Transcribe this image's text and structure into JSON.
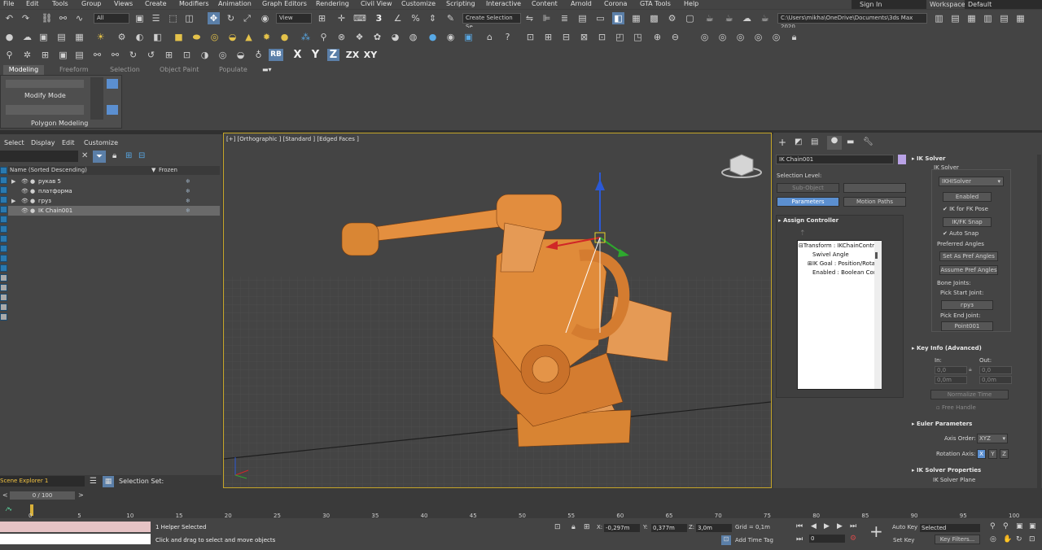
{
  "menubar": {
    "items": [
      "File",
      "Edit",
      "Tools",
      "Group",
      "Views",
      "Create",
      "Modifiers",
      "Animation",
      "Graph Editors",
      "Rendering",
      "Civil View",
      "Customize",
      "Scripting",
      "Interactive",
      "Content",
      "Arnold",
      "Corona",
      "GTA Tools",
      "Help"
    ],
    "sign_in": "Sign In",
    "workspaces_label": "Workspaces:",
    "workspaces_value": "Default"
  },
  "toolbar": {
    "filter": "All",
    "view": "View",
    "selection_set": "Create Selection Se",
    "path": "C:\\Users\\mikha\\OneDrive\\Documents\\3ds Max 2020",
    "rb": "RB",
    "x": "X",
    "y": "Y",
    "z": "Z",
    "zx": "ZX",
    "xy": "XY"
  },
  "ribbon": {
    "tabs": [
      "Modeling",
      "Freeform",
      "Selection",
      "Object Paint",
      "Populate"
    ],
    "modify_mode": "Modify Mode",
    "polygon_modeling": "Polygon Modeling"
  },
  "scene_explorer": {
    "menu": [
      "Select",
      "Display",
      "Edit",
      "Customize"
    ],
    "col_name": "Name (Sorted Descending)",
    "col_frozen": "Frozen",
    "rows": [
      {
        "name": "рукав 5",
        "tri": "▶",
        "sel": false
      },
      {
        "name": "платформа",
        "tri": "",
        "sel": false
      },
      {
        "name": "груз",
        "tri": "▶",
        "sel": false
      },
      {
        "name": "IK Chain001",
        "tri": "",
        "sel": true
      }
    ],
    "explorer_name": "Scene Explorer 1",
    "selection_set": "Selection Set:"
  },
  "viewport": {
    "label": "[+] [Orthographic ] [Standard ] [Edged Faces ]"
  },
  "command_panel": {
    "object_name": "IK Chain001",
    "selection_level": "Selection Level:",
    "sub_object": "Sub-Object",
    "parameters": "Parameters",
    "motion_paths": "Motion Paths",
    "assign_controller": "Assign Controller",
    "tree": [
      "⊟Transform : IKChainContro",
      "Swivel Angle",
      "⊞IK Goal : Position/Rotat",
      "Enabled : Boolean Con"
    ]
  },
  "ik_solver": {
    "title": "IK Solver",
    "group": "IK Solver",
    "solver": "IKHISolver",
    "enabled": "Enabled",
    "ik_fk_pose": "IK for FK Pose",
    "ik_fk_snap": "IK/FK Snap",
    "auto_snap": "Auto Snap",
    "preferred_angles": "Preferred Angles",
    "set_pref": "Set As Pref Angles",
    "assume_pref": "Assume Pref Angles",
    "bone_joints": "Bone Joints:",
    "pick_start": "Pick Start Joint:",
    "start_val": "груз",
    "pick_end": "Pick End Joint:",
    "end_val": "Point001"
  },
  "key_info": {
    "title": "Key Info (Advanced)",
    "in": "In:",
    "out": "Out:",
    "in_v1": "0,0",
    "in_v2": "0,0m",
    "out_v1": "0,0",
    "out_v2": "0,0m",
    "normalize": "Normalize Time",
    "free_handle": "Free Handle"
  },
  "euler": {
    "title": "Euler Parameters",
    "axis_order_label": "Axis Order:",
    "axis_order": "XYZ",
    "rotation_axis": "Rotation Axis:",
    "x": "X",
    "y": "Y",
    "z": "Z"
  },
  "ik_props": {
    "title": "IK Solver Properties",
    "plane": "IK Solver Plane"
  },
  "timeline": {
    "slider": "0 / 100",
    "ticks": [
      "0",
      "5",
      "10",
      "15",
      "20",
      "25",
      "30",
      "35",
      "40",
      "45",
      "50",
      "55",
      "60",
      "65",
      "70",
      "75",
      "80",
      "85",
      "90",
      "95",
      "100"
    ]
  },
  "status": {
    "line1": "1 Helper Selected",
    "line2": "Click and drag to select and move objects",
    "x_label": "X:",
    "x": "-0,297m",
    "y_label": "Y:",
    "y": "0,377m",
    "z_label": "Z:",
    "z": "3,0m",
    "grid": "Grid = 0,1m",
    "add_time_tag": "Add Time Tag",
    "auto_key": "Auto Key",
    "selected": "Selected",
    "set_key": "Set Key",
    "key_filters": "Key Filters...",
    "frame": "0"
  }
}
